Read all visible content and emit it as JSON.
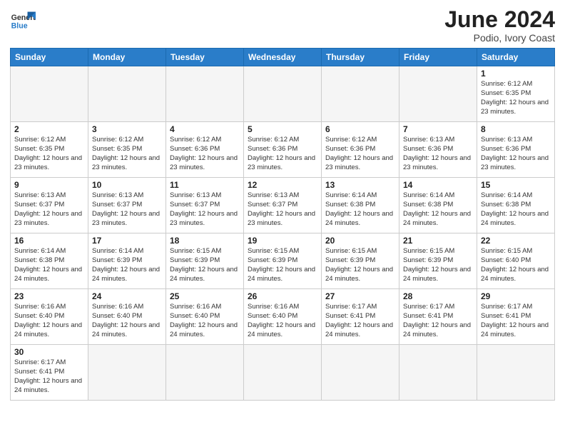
{
  "header": {
    "logo_general": "General",
    "logo_blue": "Blue",
    "title": "June 2024",
    "subtitle": "Podio, Ivory Coast"
  },
  "weekdays": [
    "Sunday",
    "Monday",
    "Tuesday",
    "Wednesday",
    "Thursday",
    "Friday",
    "Saturday"
  ],
  "weeks": [
    [
      {
        "day": "",
        "info": ""
      },
      {
        "day": "",
        "info": ""
      },
      {
        "day": "",
        "info": ""
      },
      {
        "day": "",
        "info": ""
      },
      {
        "day": "",
        "info": ""
      },
      {
        "day": "",
        "info": ""
      },
      {
        "day": "1",
        "info": "Sunrise: 6:12 AM\nSunset: 6:35 PM\nDaylight: 12 hours\nand 23 minutes."
      }
    ],
    [
      {
        "day": "2",
        "info": "Sunrise: 6:12 AM\nSunset: 6:35 PM\nDaylight: 12 hours\nand 23 minutes."
      },
      {
        "day": "3",
        "info": "Sunrise: 6:12 AM\nSunset: 6:35 PM\nDaylight: 12 hours\nand 23 minutes."
      },
      {
        "day": "4",
        "info": "Sunrise: 6:12 AM\nSunset: 6:36 PM\nDaylight: 12 hours\nand 23 minutes."
      },
      {
        "day": "5",
        "info": "Sunrise: 6:12 AM\nSunset: 6:36 PM\nDaylight: 12 hours\nand 23 minutes."
      },
      {
        "day": "6",
        "info": "Sunrise: 6:12 AM\nSunset: 6:36 PM\nDaylight: 12 hours\nand 23 minutes."
      },
      {
        "day": "7",
        "info": "Sunrise: 6:13 AM\nSunset: 6:36 PM\nDaylight: 12 hours\nand 23 minutes."
      },
      {
        "day": "8",
        "info": "Sunrise: 6:13 AM\nSunset: 6:36 PM\nDaylight: 12 hours\nand 23 minutes."
      }
    ],
    [
      {
        "day": "9",
        "info": "Sunrise: 6:13 AM\nSunset: 6:37 PM\nDaylight: 12 hours\nand 23 minutes."
      },
      {
        "day": "10",
        "info": "Sunrise: 6:13 AM\nSunset: 6:37 PM\nDaylight: 12 hours\nand 23 minutes."
      },
      {
        "day": "11",
        "info": "Sunrise: 6:13 AM\nSunset: 6:37 PM\nDaylight: 12 hours\nand 23 minutes."
      },
      {
        "day": "12",
        "info": "Sunrise: 6:13 AM\nSunset: 6:37 PM\nDaylight: 12 hours\nand 23 minutes."
      },
      {
        "day": "13",
        "info": "Sunrise: 6:14 AM\nSunset: 6:38 PM\nDaylight: 12 hours\nand 24 minutes."
      },
      {
        "day": "14",
        "info": "Sunrise: 6:14 AM\nSunset: 6:38 PM\nDaylight: 12 hours\nand 24 minutes."
      },
      {
        "day": "15",
        "info": "Sunrise: 6:14 AM\nSunset: 6:38 PM\nDaylight: 12 hours\nand 24 minutes."
      }
    ],
    [
      {
        "day": "16",
        "info": "Sunrise: 6:14 AM\nSunset: 6:38 PM\nDaylight: 12 hours\nand 24 minutes."
      },
      {
        "day": "17",
        "info": "Sunrise: 6:14 AM\nSunset: 6:39 PM\nDaylight: 12 hours\nand 24 minutes."
      },
      {
        "day": "18",
        "info": "Sunrise: 6:15 AM\nSunset: 6:39 PM\nDaylight: 12 hours\nand 24 minutes."
      },
      {
        "day": "19",
        "info": "Sunrise: 6:15 AM\nSunset: 6:39 PM\nDaylight: 12 hours\nand 24 minutes."
      },
      {
        "day": "20",
        "info": "Sunrise: 6:15 AM\nSunset: 6:39 PM\nDaylight: 12 hours\nand 24 minutes."
      },
      {
        "day": "21",
        "info": "Sunrise: 6:15 AM\nSunset: 6:39 PM\nDaylight: 12 hours\nand 24 minutes."
      },
      {
        "day": "22",
        "info": "Sunrise: 6:15 AM\nSunset: 6:40 PM\nDaylight: 12 hours\nand 24 minutes."
      }
    ],
    [
      {
        "day": "23",
        "info": "Sunrise: 6:16 AM\nSunset: 6:40 PM\nDaylight: 12 hours\nand 24 minutes."
      },
      {
        "day": "24",
        "info": "Sunrise: 6:16 AM\nSunset: 6:40 PM\nDaylight: 12 hours\nand 24 minutes."
      },
      {
        "day": "25",
        "info": "Sunrise: 6:16 AM\nSunset: 6:40 PM\nDaylight: 12 hours\nand 24 minutes."
      },
      {
        "day": "26",
        "info": "Sunrise: 6:16 AM\nSunset: 6:40 PM\nDaylight: 12 hours\nand 24 minutes."
      },
      {
        "day": "27",
        "info": "Sunrise: 6:17 AM\nSunset: 6:41 PM\nDaylight: 12 hours\nand 24 minutes."
      },
      {
        "day": "28",
        "info": "Sunrise: 6:17 AM\nSunset: 6:41 PM\nDaylight: 12 hours\nand 24 minutes."
      },
      {
        "day": "29",
        "info": "Sunrise: 6:17 AM\nSunset: 6:41 PM\nDaylight: 12 hours\nand 24 minutes."
      }
    ],
    [
      {
        "day": "30",
        "info": "Sunrise: 6:17 AM\nSunset: 6:41 PM\nDaylight: 12 hours\nand 24 minutes."
      },
      {
        "day": "",
        "info": ""
      },
      {
        "day": "",
        "info": ""
      },
      {
        "day": "",
        "info": ""
      },
      {
        "day": "",
        "info": ""
      },
      {
        "day": "",
        "info": ""
      },
      {
        "day": "",
        "info": ""
      }
    ]
  ]
}
